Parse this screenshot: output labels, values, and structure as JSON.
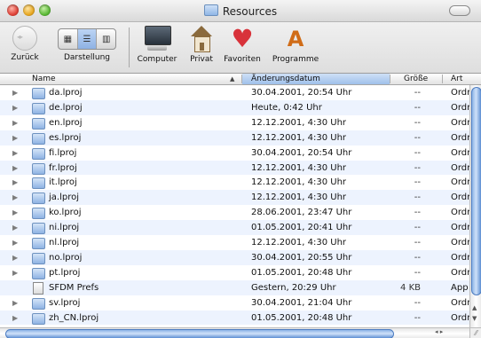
{
  "window": {
    "title": "Resources"
  },
  "toolbar": {
    "back_label": "Zurück",
    "view_label": "Darstellung",
    "view_modes": [
      "icons",
      "list",
      "columns"
    ],
    "active_view": "list",
    "shortcuts": [
      {
        "label": "Computer",
        "icon": "computer-icon"
      },
      {
        "label": "Privat",
        "icon": "home-icon"
      },
      {
        "label": "Favoriten",
        "icon": "heart-icon"
      },
      {
        "label": "Programme",
        "icon": "applications-icon"
      }
    ]
  },
  "columns": {
    "name": "Name",
    "date": "Änderungsdatum",
    "size": "Größe",
    "kind": "Art"
  },
  "rows": [
    {
      "name": "da.lproj",
      "date": "30.04.2001, 20:54 Uhr",
      "size": "--",
      "kind": "Ordner",
      "type": "folder"
    },
    {
      "name": "de.lproj",
      "date": "Heute, 0:42 Uhr",
      "size": "--",
      "kind": "Ordner",
      "type": "folder"
    },
    {
      "name": "en.lproj",
      "date": "12.12.2001, 4:30 Uhr",
      "size": "--",
      "kind": "Ordner",
      "type": "folder"
    },
    {
      "name": "es.lproj",
      "date": "12.12.2001, 4:30 Uhr",
      "size": "--",
      "kind": "Ordner",
      "type": "folder"
    },
    {
      "name": "fi.lproj",
      "date": "30.04.2001, 20:54 Uhr",
      "size": "--",
      "kind": "Ordner",
      "type": "folder"
    },
    {
      "name": "fr.lproj",
      "date": "12.12.2001, 4:30 Uhr",
      "size": "--",
      "kind": "Ordner",
      "type": "folder"
    },
    {
      "name": "it.lproj",
      "date": "12.12.2001, 4:30 Uhr",
      "size": "--",
      "kind": "Ordner",
      "type": "folder"
    },
    {
      "name": "ja.lproj",
      "date": "12.12.2001, 4:30 Uhr",
      "size": "--",
      "kind": "Ordner",
      "type": "folder"
    },
    {
      "name": "ko.lproj",
      "date": "28.06.2001, 23:47 Uhr",
      "size": "--",
      "kind": "Ordner",
      "type": "folder"
    },
    {
      "name": "ni.lproj",
      "date": "01.05.2001, 20:41 Uhr",
      "size": "--",
      "kind": "Ordner",
      "type": "folder"
    },
    {
      "name": "nl.lproj",
      "date": "12.12.2001, 4:30 Uhr",
      "size": "--",
      "kind": "Ordner",
      "type": "folder"
    },
    {
      "name": "no.lproj",
      "date": "30.04.2001, 20:55 Uhr",
      "size": "--",
      "kind": "Ordner",
      "type": "folder"
    },
    {
      "name": "pt.lproj",
      "date": "01.05.2001, 20:48 Uhr",
      "size": "--",
      "kind": "Ordner",
      "type": "folder"
    },
    {
      "name": "SFDM Prefs",
      "date": "Gestern, 20:29 Uhr",
      "size": "4 KB",
      "kind": "App",
      "type": "document"
    },
    {
      "name": "sv.lproj",
      "date": "30.04.2001, 21:04 Uhr",
      "size": "--",
      "kind": "Ordner",
      "type": "folder"
    },
    {
      "name": "zh_CN.lproj",
      "date": "01.05.2001, 20:48 Uhr",
      "size": "--",
      "kind": "Ordner",
      "type": "folder"
    }
  ]
}
